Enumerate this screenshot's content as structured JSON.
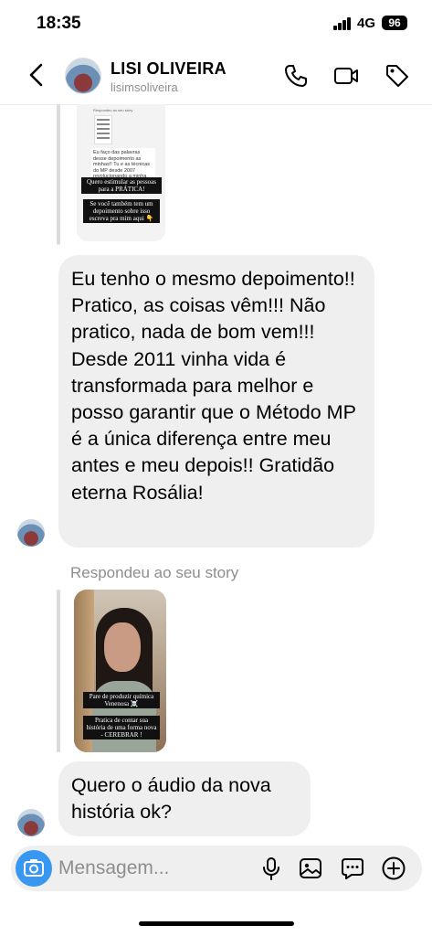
{
  "status": {
    "time": "18:35",
    "network": "4G",
    "battery": "96"
  },
  "header": {
    "name": "LISI OLIVEIRA",
    "username": "lisimsoliveira"
  },
  "story1": {
    "top_text": "Respondeu ao seu story",
    "quoted_text": "Eu faço das palavras desse depoimento as minhas!! Tu e as técnicas do MP desde 2007 revolucionando a minha vida 🙌",
    "caption1": "Quero estimular as pessoas para a PRÁTICA!",
    "caption2": "Se você também tem um depoimento sobre isso escreva pra mim aqui 👇"
  },
  "message1": "Eu tenho o mesmo depoimento!! Pratico, as coisas vêm!!! Não pratico, nada de bom vem!!! Desde 2011 vinha vida é transformada para melhor e posso garantir que o Método MP é  a única diferença entre meu antes e meu depois!! Gratidão eterna Rosália!",
  "reply_label": "Respondeu ao seu story",
  "story2": {
    "caption1": "Pare de produzir química Venenosa ☠️",
    "caption2": "Pratica de contar sua história de uma forma nova - CEREBRAR !"
  },
  "message2": "Quero o áudio da nova história ok?",
  "composer": {
    "placeholder": "Mensagem..."
  },
  "icons": {
    "back": "chevron-left-icon",
    "call": "phone-icon",
    "video": "video-camera-icon",
    "tag": "tag-icon",
    "camera": "camera-icon",
    "mic": "microphone-icon",
    "gallery": "image-icon",
    "sticker": "chat-bubble-icon",
    "add": "plus-circle-icon"
  },
  "colors": {
    "accent": "#3897f0",
    "bubble": "#efefef",
    "muted": "#8e8e8e"
  }
}
